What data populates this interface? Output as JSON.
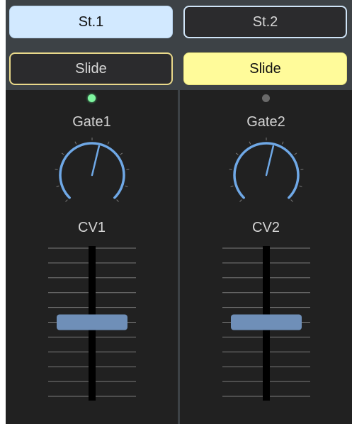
{
  "channels": [
    {
      "tab_label": "St.1",
      "tab_active": true,
      "slide_label": "Slide",
      "slide_active": false,
      "gate_led_on": true,
      "gate_label": "Gate1",
      "knob_value": 0.55,
      "cv_label": "CV1",
      "fader_value": 0.5
    },
    {
      "tab_label": "St.2",
      "tab_active": false,
      "slide_label": "Slide",
      "slide_active": true,
      "gate_led_on": false,
      "gate_label": "Gate2",
      "knob_value": 0.55,
      "cv_label": "CV2",
      "fader_value": 0.5
    }
  ],
  "colors": {
    "knob_arc": "#6fa8e6",
    "fader_cap": "#6f8fb8",
    "led_on": "#7ff5a0",
    "led_off": "#6a6a6a",
    "tab_active_bg": "#d2e9ff",
    "slide_active_bg": "#fffb9a"
  }
}
